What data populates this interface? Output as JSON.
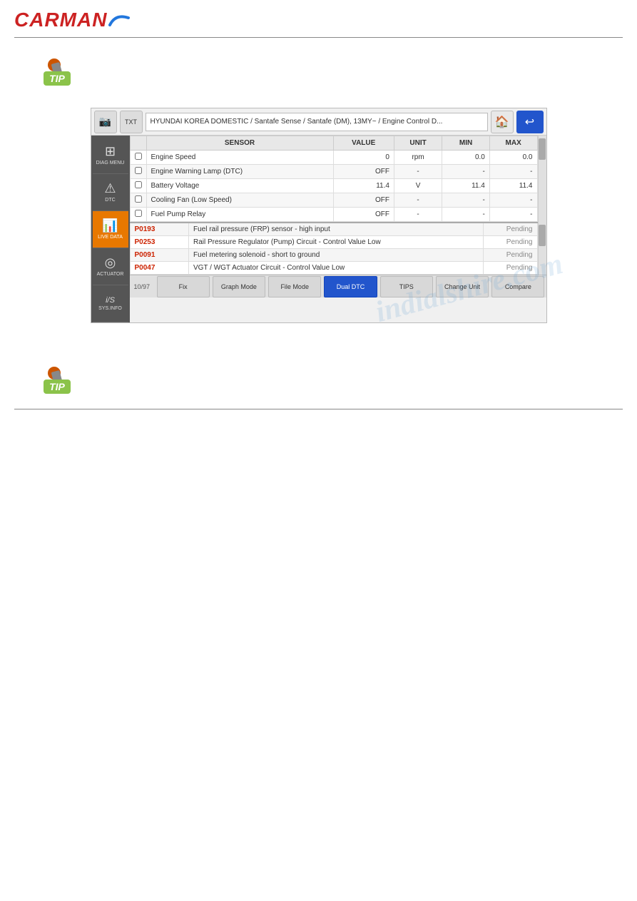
{
  "header": {
    "logo_text": "CARMAN"
  },
  "watermark": "indialshire.com",
  "screenshot": {
    "breadcrumb": "HYUNDAI KOREA DOMESTIC / Santafe Sense / Santafe (DM), 13MY~ / Engine Control D...",
    "page_num": "10/97",
    "sensor_table": {
      "columns": [
        "",
        "SENSOR",
        "VALUE",
        "UNIT",
        "MIN",
        "MAX"
      ],
      "rows": [
        {
          "checked": false,
          "name": "Engine Speed",
          "value": "0",
          "unit": "rpm",
          "min": "0.0",
          "max": "0.0"
        },
        {
          "checked": false,
          "name": "Engine Warning Lamp (DTC)",
          "value": "OFF",
          "unit": "-",
          "min": "-",
          "max": "-"
        },
        {
          "checked": false,
          "name": "Battery Voltage",
          "value": "11.4",
          "unit": "V",
          "min": "11.4",
          "max": "11.4"
        },
        {
          "checked": false,
          "name": "Cooling Fan (Low Speed)",
          "value": "OFF",
          "unit": "-",
          "min": "-",
          "max": "-"
        },
        {
          "checked": false,
          "name": "Fuel Pump Relay",
          "value": "OFF",
          "unit": "-",
          "min": "-",
          "max": "-"
        }
      ]
    },
    "dtc_table": {
      "rows": [
        {
          "code": "P0193",
          "description": "Fuel rail pressure (FRP) sensor - high input",
          "status": "Pending"
        },
        {
          "code": "P0253",
          "description": "Rail Pressure Regulator (Pump) Circuit - Control Value Low",
          "status": "Pending"
        },
        {
          "code": "P0091",
          "description": "Fuel metering solenoid - short to ground",
          "status": "Pending"
        },
        {
          "code": "P0047",
          "description": "VGT / WGT Actuator Circuit - Control Value Low",
          "status": "Pending"
        }
      ]
    },
    "sidebar": {
      "items": [
        {
          "id": "diag-menu",
          "label": "DIAG MENU",
          "icon": "⊞"
        },
        {
          "id": "dtc",
          "label": "DTC",
          "icon": "⚠"
        },
        {
          "id": "live-data",
          "label": "LIVE DATA",
          "icon": "📊"
        },
        {
          "id": "actuator",
          "label": "ACTUATOR",
          "icon": "◎"
        },
        {
          "id": "sys-info",
          "label": "SYS.INFO",
          "icon": "i/S"
        }
      ]
    },
    "toolbar": {
      "buttons": [
        {
          "label": "Fix",
          "active": false
        },
        {
          "label": "Graph Mode",
          "active": false
        },
        {
          "label": "File Mode",
          "active": false
        },
        {
          "label": "Dual DTC",
          "active": true
        },
        {
          "label": "TIPS",
          "active": false
        },
        {
          "label": "Change Unit",
          "active": false
        },
        {
          "label": "Compare",
          "active": false
        }
      ]
    }
  }
}
